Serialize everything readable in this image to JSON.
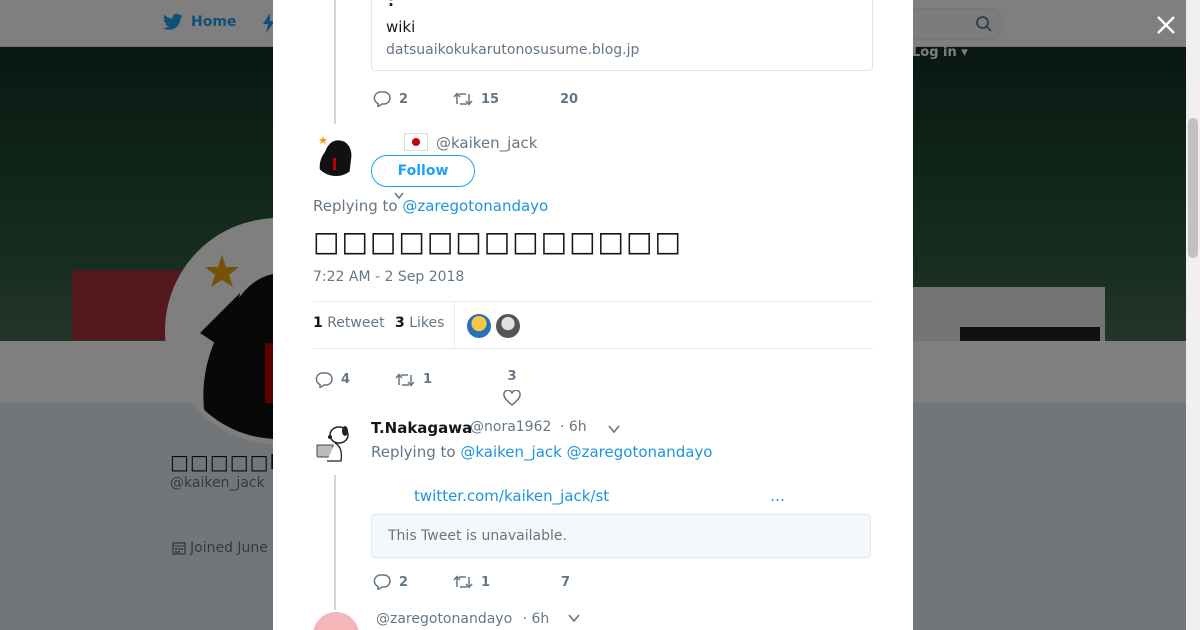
{
  "nav": {
    "home_label": "Home",
    "login_label": "Log in"
  },
  "profile": {
    "name": "□□□□□L",
    "handle": "@kaiken_jack",
    "joined": "Joined June"
  },
  "prev_tweet": {
    "card_colon": ":",
    "card_title": "wiki",
    "card_domain": "datsuaikokukarutonosusume.blog.jp",
    "replies": "2",
    "retweets": "15",
    "likes": "20"
  },
  "main_tweet": {
    "handle": "@kaiken_jack",
    "follow_label": "Follow",
    "replying_prefix": "Replying to",
    "replying_to": "@zaregotonandayo",
    "text": "□□□□□□□□□□□□□",
    "timestamp": "7:22 AM - 2 Sep 2018",
    "retweet_count": "1",
    "retweet_label": "Retweet",
    "like_count": "3",
    "like_label": "Likes",
    "replies": "4",
    "retweets": "1",
    "likes": "3"
  },
  "reply_tweet": {
    "name": "T.Nakagawa",
    "handle": "@nora1962",
    "time": "· 6h",
    "replying_prefix": "Replying to",
    "replying_to_1": "@kaiken_jack",
    "replying_to_2": "@zaregotonandayo",
    "link_text": "twitter.com/kaiken_jack/st",
    "link_ellipsis": "…",
    "unavailable": "This Tweet is unavailable.",
    "replies": "2",
    "retweets": "1",
    "likes": "7"
  },
  "last_tweet": {
    "handle": "@zaregotonandayo",
    "time": "· 6h"
  },
  "colors": {
    "accent": "#1da1f2",
    "link": "#1b95e0",
    "text": "#14171a",
    "muted": "#657786"
  }
}
